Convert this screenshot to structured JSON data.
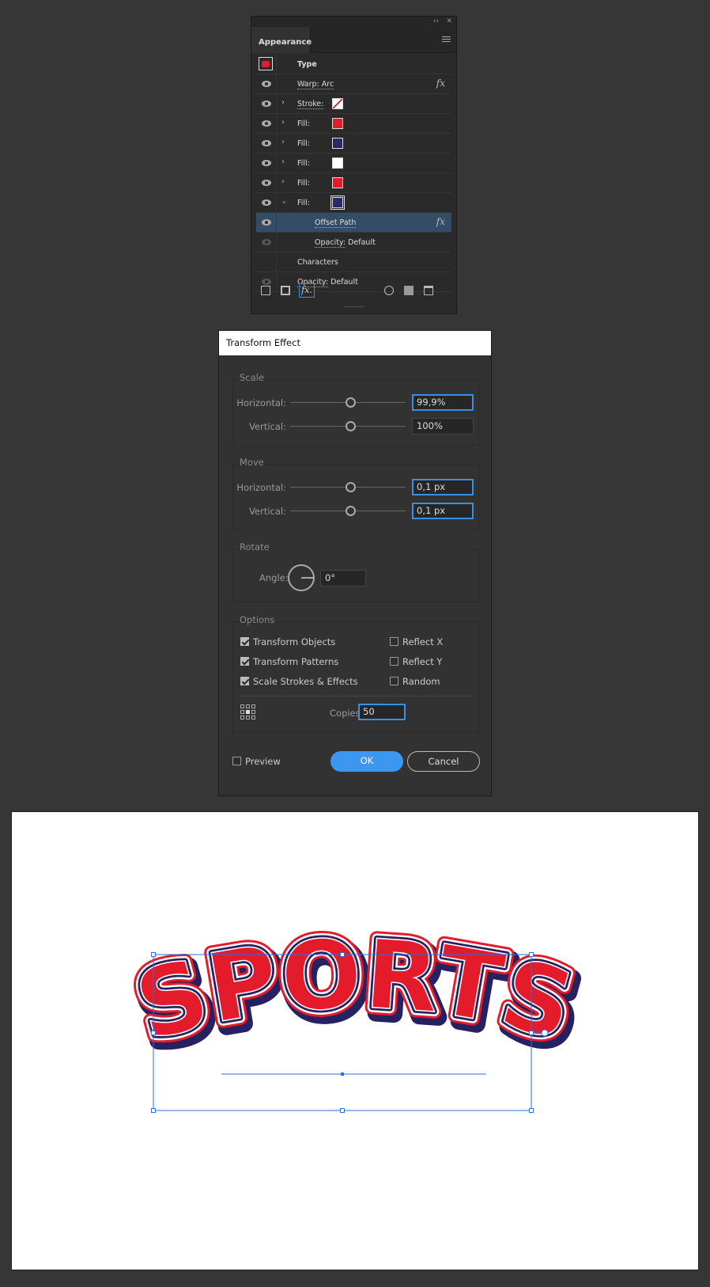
{
  "appearance": {
    "tab": "Appearance",
    "rows": [
      {
        "label": "Type"
      },
      {
        "key": "Warp: Arc",
        "fx": "fx"
      },
      {
        "key": "Stroke:"
      },
      {
        "key": "Fill:",
        "color": "#e31b2a"
      },
      {
        "key": "Fill:",
        "color": "#2a2a66"
      },
      {
        "key": "Fill:",
        "color": "#ffffff"
      },
      {
        "key": "Fill:",
        "color": "#e31b2a"
      },
      {
        "key": "Fill:",
        "color": "#2a2a66"
      },
      {
        "key": "Offset Path",
        "fx": "fx"
      },
      {
        "key": "Opacity:",
        "value": "Default"
      },
      {
        "label": "Characters"
      },
      {
        "key": "Opacity:",
        "value": "Default"
      }
    ],
    "fx_button": "fx."
  },
  "dialog": {
    "title": "Transform Effect",
    "scale": {
      "legend": "Scale",
      "horizontal_label": "Horizontal:",
      "horizontal_value": "99,9%",
      "vertical_label": "Vertical:",
      "vertical_value": "100%"
    },
    "move": {
      "legend": "Move",
      "horizontal_label": "Horizontal:",
      "horizontal_value": "0,1 px",
      "vertical_label": "Vertical:",
      "vertical_value": "0,1 px"
    },
    "rotate": {
      "legend": "Rotate",
      "angle_label": "Angle:",
      "angle_value": "0°"
    },
    "options": {
      "legend": "Options",
      "transform_objects": "Transform Objects",
      "transform_patterns": "Transform Patterns",
      "scale_strokes": "Scale Strokes & Effects",
      "reflect_x": "Reflect X",
      "reflect_y": "Reflect Y",
      "random": "Random",
      "copies_label": "Copies",
      "copies_value": "50"
    },
    "preview": "Preview",
    "ok": "OK",
    "cancel": "Cancel"
  },
  "canvas": {
    "artwork_text": "SPORTS",
    "colors": {
      "red": "#e31b2a",
      "navy": "#262262",
      "selection": "#2f6fd6"
    }
  }
}
